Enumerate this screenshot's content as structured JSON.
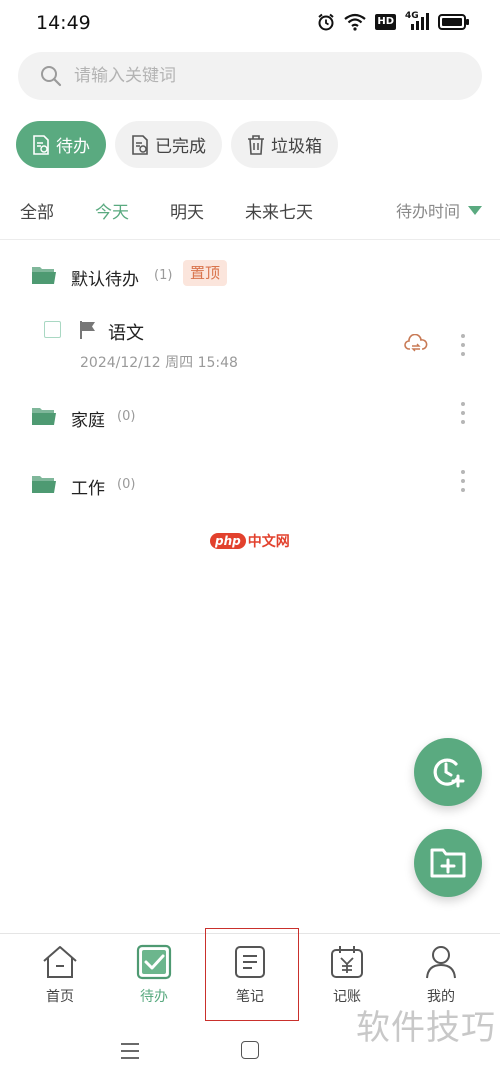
{
  "status_bar": {
    "time": "14:49",
    "icons": [
      "alarm-icon",
      "wifi-icon",
      "hd-icon",
      "signal-4g-icon",
      "battery-icon"
    ],
    "hd_text": "HD",
    "network_text": "4G"
  },
  "search": {
    "placeholder": "请输入关键词",
    "value": ""
  },
  "chips": [
    {
      "label": "待办",
      "icon": "todo-doc-icon",
      "active": true
    },
    {
      "label": "已完成",
      "icon": "done-doc-icon",
      "active": false
    },
    {
      "label": "垃圾箱",
      "icon": "trash-icon",
      "active": false
    }
  ],
  "date_tabs": [
    {
      "label": "全部",
      "active": false
    },
    {
      "label": "今天",
      "active": true
    },
    {
      "label": "明天",
      "active": false
    },
    {
      "label": "未来七天",
      "active": false
    }
  ],
  "sort": {
    "label": "待办时间",
    "icon": "triangle-down-icon"
  },
  "groups": [
    {
      "name": "默认待办",
      "count": "(1)",
      "badge": "置顶"
    },
    {
      "name": "家庭",
      "count": "(0)"
    },
    {
      "name": "工作",
      "count": "(0)"
    }
  ],
  "todo": {
    "title": "语文",
    "datetime": "2024/12/12 周四 15:48",
    "icons": [
      "flag-icon",
      "cloud-sync-icon"
    ]
  },
  "watermark_php": {
    "badge": "php",
    "text": "中文网"
  },
  "fabs": [
    {
      "icon": "add-reminder-icon"
    },
    {
      "icon": "add-folder-icon"
    }
  ],
  "bottom_nav": [
    {
      "label": "首页",
      "icon": "home-icon",
      "active": false
    },
    {
      "label": "待办",
      "icon": "checkbox-icon",
      "active": true
    },
    {
      "label": "笔记",
      "icon": "note-icon",
      "active": false
    },
    {
      "label": "记账",
      "icon": "ledger-icon",
      "active": false
    },
    {
      "label": "我的",
      "icon": "profile-icon",
      "active": false
    }
  ],
  "watermark_bottom": "软件技巧",
  "colors": {
    "accent": "#5aaa80",
    "pin_bg": "#fbe5dc",
    "pin_text": "#d9744c",
    "highlight": "#c9302c"
  }
}
